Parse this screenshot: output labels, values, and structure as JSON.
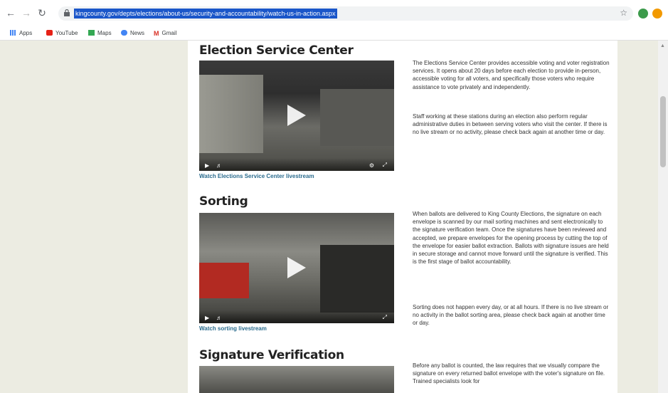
{
  "browser": {
    "url": "kingcounty.gov/depts/elections/about-us/security-and-accountability/watch-us-in-action.aspx",
    "bookmarks": [
      "Apps",
      "YouTube",
      "Maps",
      "News",
      "Gmail"
    ]
  },
  "sections": [
    {
      "heading": "Election Service Center",
      "link": "Watch Elections Service Center livestream",
      "paragraphs": [
        "The Elections Service Center provides accessible voting and voter registration services. It opens about 20 days before each election to provide in-person, accessible voting for all voters, and specifically those voters who require assistance to vote privately and independently.",
        "Staff working at these stations during an election also perform regular administrative duties in between serving voters who visit the center. If there is no live stream or no activity, please check back again at another time or day."
      ]
    },
    {
      "heading": "Sorting",
      "link": "Watch sorting livestream",
      "paragraphs": [
        "When ballots are delivered to King County Elections, the signature on each envelope is scanned by our mail sorting machines and sent electronically to the signature verification team. Once the signatures have been reviewed and accepted, we prepare envelopes for the opening process by cutting the top of the envelope for easier ballot extraction. Ballots with signature issues are held in secure storage and cannot move forward until the signature is verified. This is the first stage of ballot accountability.",
        "Sorting does not happen every day, or at all hours. If there is no live stream or no activity in the ballot sorting area, please check back again at another time or day."
      ]
    },
    {
      "heading": "Signature Verification",
      "paragraphs": [
        "Before any ballot is counted, the law requires that we visually compare the signature on every returned ballot envelope with the voter's signature on file. Trained specialists look for"
      ]
    }
  ]
}
